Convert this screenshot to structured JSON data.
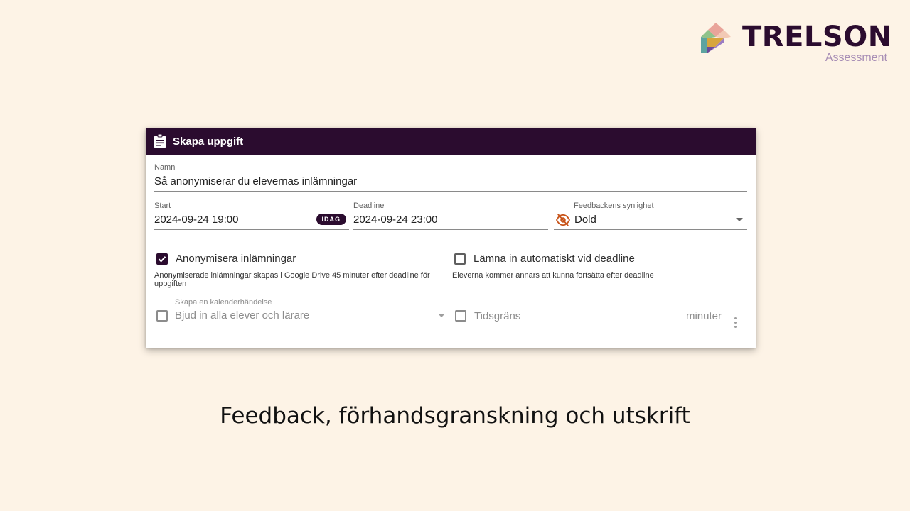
{
  "brand": {
    "name": "TRELSON",
    "subtitle": "Assessment",
    "text_color": "#2b0c2f",
    "subtitle_color": "#a78db5"
  },
  "dialog": {
    "title": "Skapa uppgift",
    "header_icon": "clipboard-icon",
    "header_color": "#2b0c2f",
    "name_field": {
      "label": "Namn",
      "value": "Så anonymiserar du elevernas inlämningar"
    },
    "start_field": {
      "label": "Start",
      "value": "2024-09-24 19:00",
      "today_button": "IDAG"
    },
    "deadline_field": {
      "label": "Deadline",
      "value": "2024-09-24 23:00"
    },
    "visibility_field": {
      "label": "Feedbackens synlighet",
      "value": "Dold",
      "icon": "eye-off-icon",
      "icon_color": "#c8541a"
    },
    "anonymize": {
      "label": "Anonymisera inlämningar",
      "checked": true,
      "help": "Anonymiserade inlämningar skapas i Google Drive 45 minuter efter deadline för uppgiften"
    },
    "auto_submit": {
      "label": "Lämna in automatiskt vid deadline",
      "checked": false,
      "help": "Eleverna kommer annars att kunna fortsätta efter deadline"
    },
    "calendar": {
      "label": "Skapa en kalenderhändelse",
      "value": "Bjud in alla elever och lärare",
      "checked": false
    },
    "time_limit": {
      "label": "Tidsgräns",
      "unit": "minuter",
      "checked": false
    }
  },
  "caption": "Feedback, förhandsgranskning och utskrift"
}
